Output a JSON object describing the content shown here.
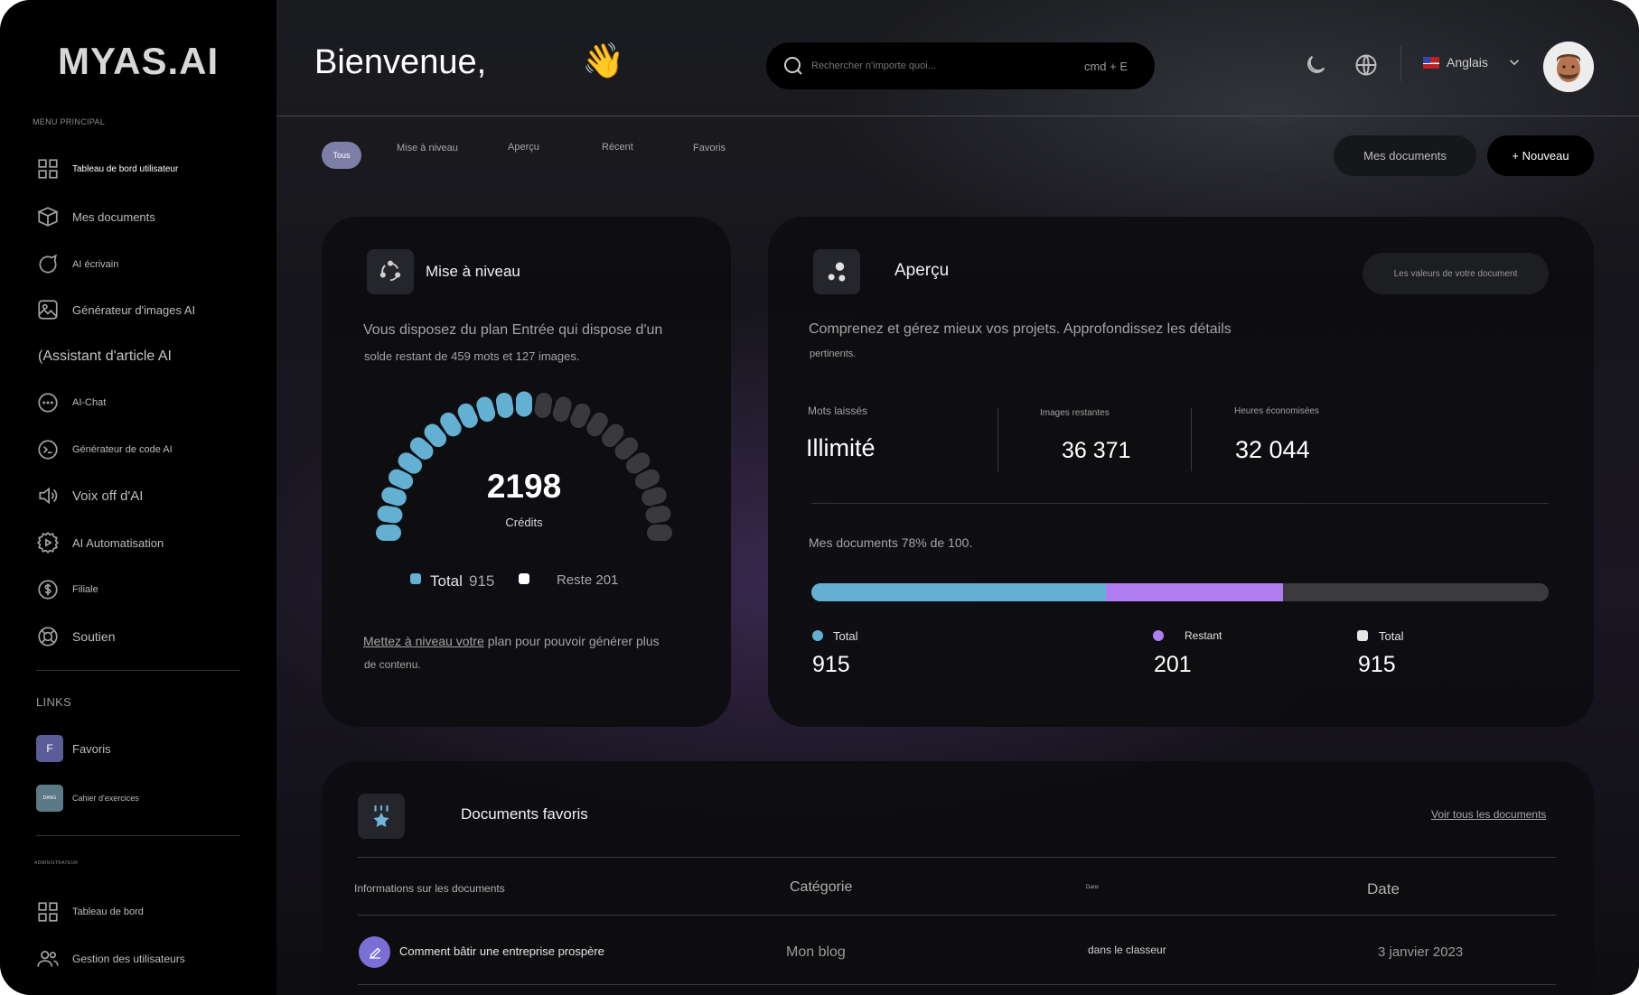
{
  "app": {
    "logo": "MYAS.AI"
  },
  "sidebar": {
    "menu_label": "MENU PRINCIPAL",
    "items": [
      {
        "label": "Tableau de bord utilisateur",
        "icon": "grid-icon"
      },
      {
        "label": "Mes documents",
        "icon": "box-icon"
      },
      {
        "label": "AI écrivain",
        "icon": "chat-bubble-icon"
      },
      {
        "label": "Générateur d'images AI",
        "icon": "image-icon"
      },
      {
        "label": "(Assistant d'article AI",
        "icon": ""
      },
      {
        "label": "AI-Chat",
        "icon": "chat-dots-icon"
      },
      {
        "label": "Générateur de code AI",
        "icon": "terminal-icon"
      },
      {
        "label": "Voix off d'AI",
        "icon": "speaker-icon"
      },
      {
        "label": "AI Automatisation",
        "icon": "gear-play-icon"
      },
      {
        "label": "Filiale",
        "icon": "dollar-icon"
      },
      {
        "label": "Soutien",
        "icon": "lifebuoy-icon"
      }
    ],
    "links_label": "LINKS",
    "links": [
      {
        "badge": "F",
        "label": "Favoris",
        "color": "#5b5d98"
      },
      {
        "badge": "DANG",
        "label": "Cahier d'exercices",
        "color": "#5b7a86"
      }
    ],
    "admin_label": "ADMINISTRATEUR",
    "admin_items": [
      {
        "label": "Tableau de bord",
        "icon": "grid-icon"
      },
      {
        "label": "Gestion des utilisateurs",
        "icon": "users-icon"
      }
    ]
  },
  "header": {
    "greeting": "Bienvenue,",
    "wave": "👋",
    "search_placeholder": "Rechercher n'importe quoi...",
    "search_shortcut": "cmd + E",
    "language": "Anglais"
  },
  "tabs": [
    "Tous",
    "Mise à niveau",
    "Aperçu",
    "Récent",
    "Favoris"
  ],
  "actions": {
    "docs": "Mes documents",
    "new": "+ Nouveau"
  },
  "upgrade": {
    "title": "Mise à niveau",
    "line1": "Vous disposez du plan Entrée qui dispose d'un",
    "line2": "solde restant de 459 mots et 127 images.",
    "credits_value": "2198",
    "credits_label": "Crédits",
    "gauge_fraction": 0.5,
    "legend_total_label": "Total",
    "legend_total_value": "915",
    "legend_rest": "Reste 201",
    "footer_link": "Mettez à niveau votre",
    "footer_rest": " plan pour pouvoir générer plus",
    "footer_line2": "de contenu.",
    "total_color": "#63b0d3",
    "rest_color": "#3a3a3e"
  },
  "overview": {
    "title": "Aperçu",
    "pill": "Les valeurs de votre document",
    "line1": "Comprenez et gérez mieux vos projets. Approfondissez les détails",
    "line2": "pertinents.",
    "stats": [
      {
        "label": "Mots laissés",
        "value": "Illimité"
      },
      {
        "label": "Images restantes",
        "value": "36 371"
      },
      {
        "label": "Heures économisées",
        "value": "32 044"
      }
    ],
    "docs_line": "Mes documents 78% de 100.",
    "bar": [
      {
        "fraction": 0.4,
        "color": "#63b0d3"
      },
      {
        "fraction": 0.24,
        "color": "#b07ef0"
      }
    ],
    "legend": [
      {
        "label": "Total",
        "value": "915",
        "color": "#63b0d3"
      },
      {
        "label": "Restant",
        "value": "201",
        "color": "#b07ef0"
      },
      {
        "label": "Total",
        "value": "915",
        "color": "#e6e6e6"
      }
    ]
  },
  "favorites": {
    "title": "Documents favoris",
    "view_all": "Voir tous les documents",
    "columns": [
      "Informations sur les documents",
      "Catégorie",
      "Dans",
      "Date"
    ],
    "rows": [
      {
        "name": "Comment bâtir une entreprise prospère",
        "category": "Mon blog",
        "in": "dans le classeur",
        "date": "3 janvier 2023"
      }
    ]
  }
}
